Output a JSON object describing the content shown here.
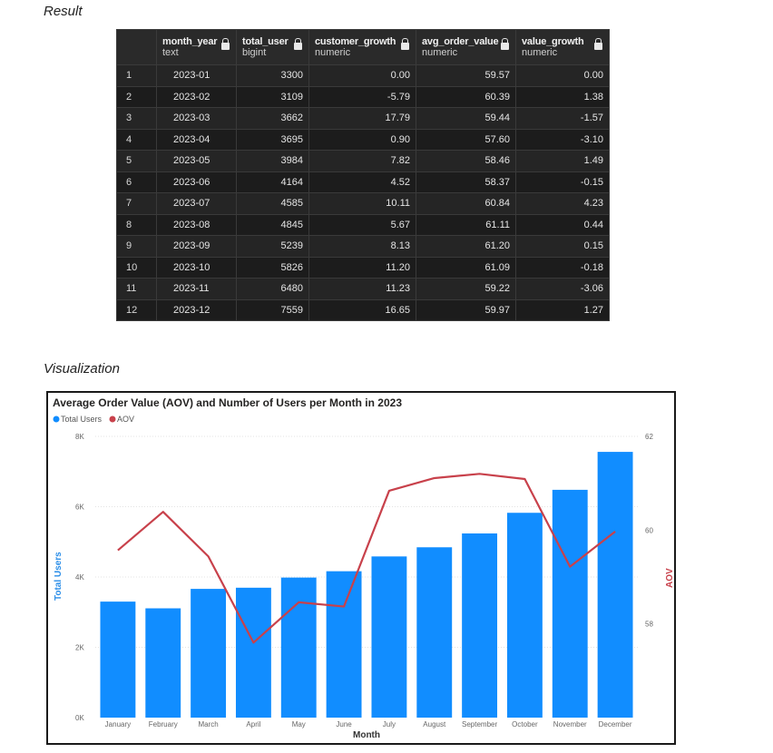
{
  "result_label": "Result",
  "visualization_label": "Visualization",
  "table": {
    "columns": [
      {
        "name": "",
        "type": ""
      },
      {
        "name": "month_year",
        "type": "text"
      },
      {
        "name": "total_user",
        "type": "bigint"
      },
      {
        "name": "customer_growth",
        "type": "numeric"
      },
      {
        "name": "avg_order_value",
        "type": "numeric"
      },
      {
        "name": "value_growth",
        "type": "numeric"
      }
    ],
    "rows": [
      [
        "1",
        "2023-01",
        "3300",
        "0.00",
        "59.57",
        "0.00"
      ],
      [
        "2",
        "2023-02",
        "3109",
        "-5.79",
        "60.39",
        "1.38"
      ],
      [
        "3",
        "2023-03",
        "3662",
        "17.79",
        "59.44",
        "-1.57"
      ],
      [
        "4",
        "2023-04",
        "3695",
        "0.90",
        "57.60",
        "-3.10"
      ],
      [
        "5",
        "2023-05",
        "3984",
        "7.82",
        "58.46",
        "1.49"
      ],
      [
        "6",
        "2023-06",
        "4164",
        "4.52",
        "58.37",
        "-0.15"
      ],
      [
        "7",
        "2023-07",
        "4585",
        "10.11",
        "60.84",
        "4.23"
      ],
      [
        "8",
        "2023-08",
        "4845",
        "5.67",
        "61.11",
        "0.44"
      ],
      [
        "9",
        "2023-09",
        "5239",
        "8.13",
        "61.20",
        "0.15"
      ],
      [
        "10",
        "2023-10",
        "5826",
        "11.20",
        "61.09",
        "-0.18"
      ],
      [
        "11",
        "2023-11",
        "6480",
        "11.23",
        "59.22",
        "-3.06"
      ],
      [
        "12",
        "2023-12",
        "7559",
        "16.65",
        "59.97",
        "1.27"
      ]
    ]
  },
  "chart_data": {
    "type": "bar",
    "title": "Average Order Value (AOV) and Number of Users per Month in 2023",
    "xlabel": "Month",
    "ylabel": "Total Users",
    "y2label": "AOV",
    "categories": [
      "January",
      "February",
      "March",
      "April",
      "May",
      "June",
      "July",
      "August",
      "September",
      "October",
      "November",
      "December"
    ],
    "series": [
      {
        "name": "Total Users",
        "type": "bar",
        "axis": "left",
        "color": "#118dff",
        "values": [
          3300,
          3109,
          3662,
          3695,
          3984,
          4164,
          4585,
          4845,
          5239,
          5826,
          6480,
          7559
        ]
      },
      {
        "name": "AOV",
        "type": "line",
        "axis": "right",
        "color": "#c8414b",
        "values": [
          59.57,
          60.39,
          59.44,
          57.6,
          58.46,
          58.37,
          60.84,
          61.11,
          61.2,
          61.09,
          59.22,
          59.97
        ]
      }
    ],
    "ylim": [
      0,
      8000
    ],
    "y2lim": [
      56,
      62
    ],
    "yticks": [
      "0K",
      "2K",
      "4K",
      "6K",
      "8K"
    ],
    "y2ticks": [
      "58",
      "60",
      "62"
    ],
    "legend_position": "top-left",
    "grid": true
  }
}
